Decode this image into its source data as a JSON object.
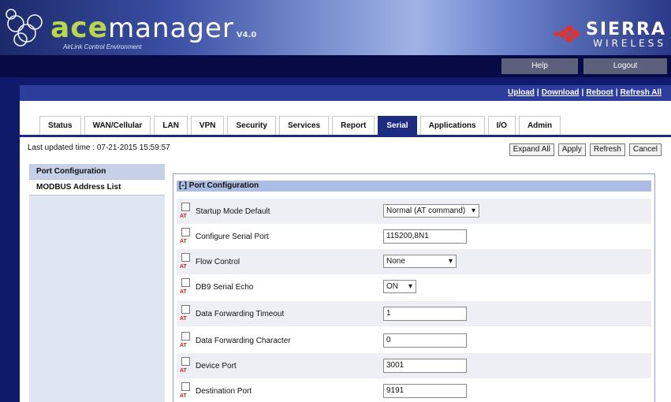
{
  "header": {
    "logo_ace": "ace",
    "logo_manager": "manager",
    "version": "V4.0",
    "subtitle": "AirLink Control Environment",
    "brand_line1": "SIERRA",
    "brand_line2": "WIRELESS"
  },
  "topbar": {
    "help": "Help",
    "logout": "Logout"
  },
  "links": {
    "upload": "Upload",
    "download": "Download",
    "reboot": "Reboot",
    "refresh_all": "Refresh All",
    "separator": "|"
  },
  "tabs": [
    {
      "label": "Status"
    },
    {
      "label": "WAN/Cellular"
    },
    {
      "label": "LAN"
    },
    {
      "label": "VPN"
    },
    {
      "label": "Security"
    },
    {
      "label": "Services"
    },
    {
      "label": "Report"
    },
    {
      "label": "Serial"
    },
    {
      "label": "Applications"
    },
    {
      "label": "I/O"
    },
    {
      "label": "Admin"
    }
  ],
  "active_tab": "Serial",
  "updated": "Last updated time : 07-21-2015 15:59:57",
  "actions": {
    "expand_all": "Expand All",
    "apply": "Apply",
    "refresh": "Refresh",
    "cancel": "Cancel"
  },
  "sidebar": {
    "items": [
      {
        "label": "Port Configuration"
      },
      {
        "label": "MODBUS Address List"
      }
    ]
  },
  "section": {
    "title": "[-] Port Configuration"
  },
  "rows": [
    {
      "label": "Startup Mode Default",
      "value": "Normal (AT command)",
      "type": "select",
      "at": "AT"
    },
    {
      "label": "Configure Serial Port",
      "value": "115200,8N1",
      "type": "input",
      "at": "AT"
    },
    {
      "label": "Flow Control",
      "value": "None",
      "type": "select",
      "at": "AT"
    },
    {
      "label": "DB9 Serial Echo",
      "value": "ON",
      "type": "select",
      "at": "AT"
    },
    {
      "label": "Data Forwarding Timeout",
      "value": "1",
      "type": "input",
      "at": "AT"
    },
    {
      "label": "Data Forwarding Character",
      "value": "0",
      "type": "input",
      "at": "AT"
    },
    {
      "label": "Device Port",
      "value": "3001",
      "type": "input",
      "at": "AT"
    },
    {
      "label": "Destination Port",
      "value": "9191",
      "type": "input",
      "at": "AT"
    }
  ],
  "icons": {
    "dropdown": "chevron-down-icon"
  },
  "colors": {
    "brand_green": "#b8d74b",
    "nav_dark": "#070a44",
    "tab_active": "#1c2c80",
    "at_red": "#d62020"
  }
}
